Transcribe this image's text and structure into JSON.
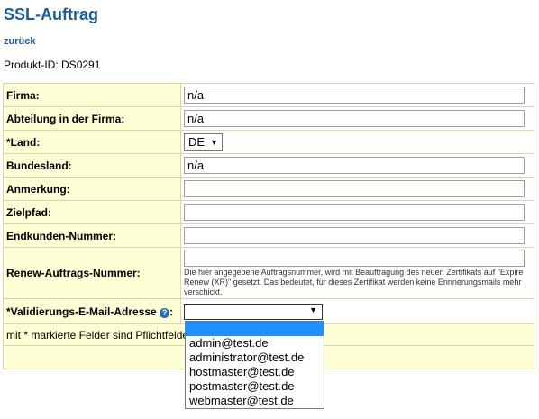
{
  "header": {
    "title": "SSL-Auftrag",
    "back_link": "zurück",
    "product_id": "Produkt-ID: DS0291"
  },
  "form": {
    "firma": {
      "label": "Firma:",
      "value": "n/a"
    },
    "abteilung": {
      "label": "Abteilung in der Firma:",
      "value": "n/a"
    },
    "land": {
      "label": "*Land:",
      "value": "DE"
    },
    "bundesland": {
      "label": "Bundesland:",
      "value": "n/a"
    },
    "anmerkung": {
      "label": "Anmerkung:",
      "value": ""
    },
    "zielpfad": {
      "label": "Zielpfad:",
      "value": ""
    },
    "endkunden": {
      "label": "Endkunden-Nummer:",
      "value": ""
    },
    "renew": {
      "label": "Renew-Auftrags-Nummer:",
      "value": "",
      "hint": "Die hier angegebene Auftragsnummer, wird mit Beauftragung des neuen Zertifikats auf \"Expire Renew (XR)\" gesetzt. Das bedeutet, für dieses Zertifikat werden keine Erinnerungsmails mehr verschickt."
    },
    "validierung": {
      "label": "*Validierungs-E-Mail-Adresse",
      "label_suffix": ":",
      "value": "",
      "options": [
        "",
        "admin@test.de",
        "administrator@test.de",
        "hostmaster@test.de",
        "postmaster@test.de",
        "webmaster@test.de"
      ]
    },
    "required_note": "mit * markierte Felder sind Pflichtfelder"
  },
  "colors": {
    "accent": "#1c5b9c",
    "label_bg": "#ffffd5",
    "selected": "#1e90ff"
  },
  "icons": {
    "help": "help-circle-icon",
    "dropdown": "chevron-down-icon"
  }
}
